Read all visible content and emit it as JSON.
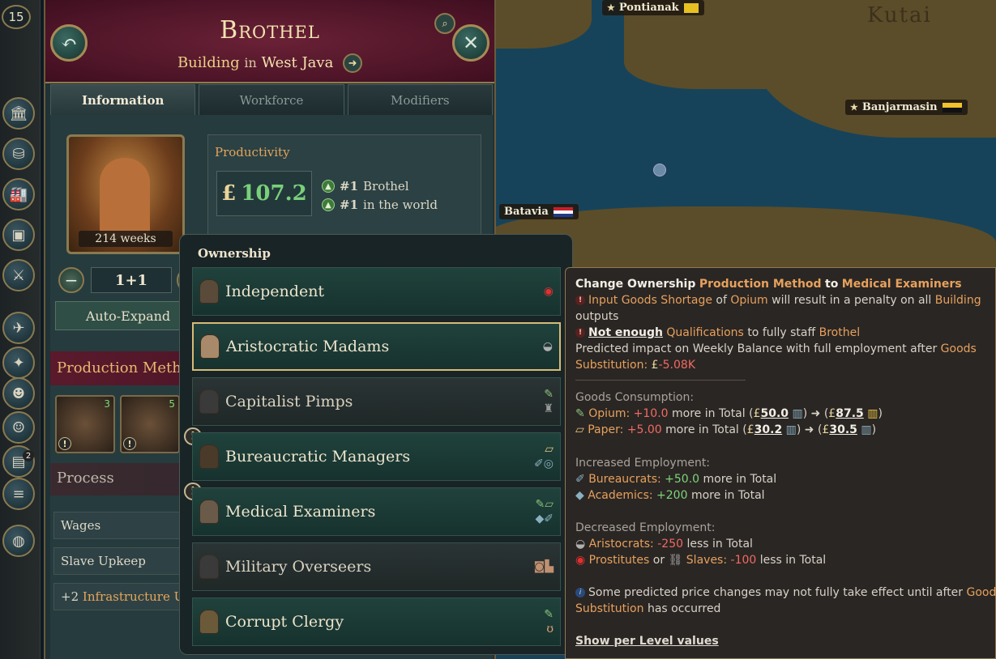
{
  "game": {
    "date_badge": "15"
  },
  "header": {
    "title": "Brothel",
    "subtitle_type": "Building",
    "subtitle_in": "in",
    "subtitle_location": "West Java"
  },
  "tabs": [
    {
      "label": "Information",
      "active": true
    },
    {
      "label": "Workforce",
      "active": false
    },
    {
      "label": "Modifiers",
      "active": false
    }
  ],
  "info": {
    "portrait_weeks": "214 weeks",
    "productivity_label": "Productivity",
    "productivity_value": "107.2",
    "currency_symbol": "£",
    "rank_1_num": "#1",
    "rank_1_text": "Brothel",
    "rank_2_num": "#1",
    "rank_2_text": "in the world",
    "level": "1+1",
    "auto_expand": "Auto-Expand",
    "production_methods_label": "Production Methods",
    "pm_cards": [
      {
        "count": "3"
      },
      {
        "count": "5"
      }
    ],
    "process_label": "Process",
    "process_rows": [
      "Wages",
      "Slave Upkeep"
    ],
    "infra_prefix": "+2",
    "infra_text": "Infrastructure Usage"
  },
  "leftbar": {
    "notification_count": "2"
  },
  "map": {
    "labels": [
      "Pontianak",
      "Banjarmasin",
      "Batavia"
    ],
    "regions": [
      "Kutai"
    ]
  },
  "ownership": {
    "title": "Ownership",
    "options": [
      {
        "label": "Independent",
        "selected": false,
        "warning": false
      },
      {
        "label": "Aristocratic Madams",
        "selected": true,
        "warning": false
      },
      {
        "label": "Capitalist Pimps",
        "selected": false,
        "warning": false
      },
      {
        "label": "Bureaucratic Managers",
        "selected": false,
        "warning": true
      },
      {
        "label": "Medical Examiners",
        "selected": false,
        "warning": true
      },
      {
        "label": "Military Overseers",
        "selected": false,
        "warning": false
      },
      {
        "label": "Corrupt Clergy",
        "selected": false,
        "warning": false
      }
    ]
  },
  "tooltip": {
    "title_a": "Change Ownership",
    "title_b": "Production Method",
    "title_c": "to",
    "title_d": "Medical Examiners",
    "w1_a": "Input Goods Shortage",
    "w1_b": "of",
    "w1_c": "Opium",
    "w1_d": "will result in a penalty on all",
    "w1_e": "Building",
    "w1_f": "outputs",
    "w2_a": "Not enough",
    "w2_b": "Qualifications",
    "w2_c": "to fully staff",
    "w2_d": "Brothel",
    "impact_a": "Predicted impact on Weekly Balance with full employment after",
    "impact_b": "Goods",
    "impact_c": "Substitution:",
    "impact_value": "-5.08K",
    "goods_heading": "Goods Consumption:",
    "opium_label": "Opium:",
    "opium_delta": "+10.0",
    "opium_more": "more in Total (",
    "opium_price": "50.0",
    "opium_new": "87.5",
    "paper_label": "Paper:",
    "paper_delta": "+5.00",
    "paper_more": "more in Total (",
    "paper_price": "30.2",
    "paper_new": "30.5",
    "inc_heading": "Increased Employment:",
    "bur_label": "Bureaucrats:",
    "bur_val": "+50.0",
    "bur_more": "more in Total",
    "aca_label": "Academics:",
    "aca_val": "+200",
    "aca_more": "more in Total",
    "dec_heading": "Decreased Employment:",
    "ari_label": "Aristocrats:",
    "ari_val": "-250",
    "ari_less": "less in Total",
    "pros_label": "Prostitutes",
    "or_word": "or",
    "slaves_label": "Slaves:",
    "slaves_val": "-100",
    "slaves_less": "less in Total",
    "note_a": "Some predicted price changes may not fully take effect until after",
    "note_b": "Goods",
    "note_c": "Substitution",
    "note_d": "has occurred",
    "show_per_level": "Show per Level values"
  },
  "colors": {
    "accent_orange": "#e7a15c",
    "positive_green": "#7dd47a",
    "negative_red": "#f06a62",
    "header_maroon": "#5a1a2c"
  }
}
